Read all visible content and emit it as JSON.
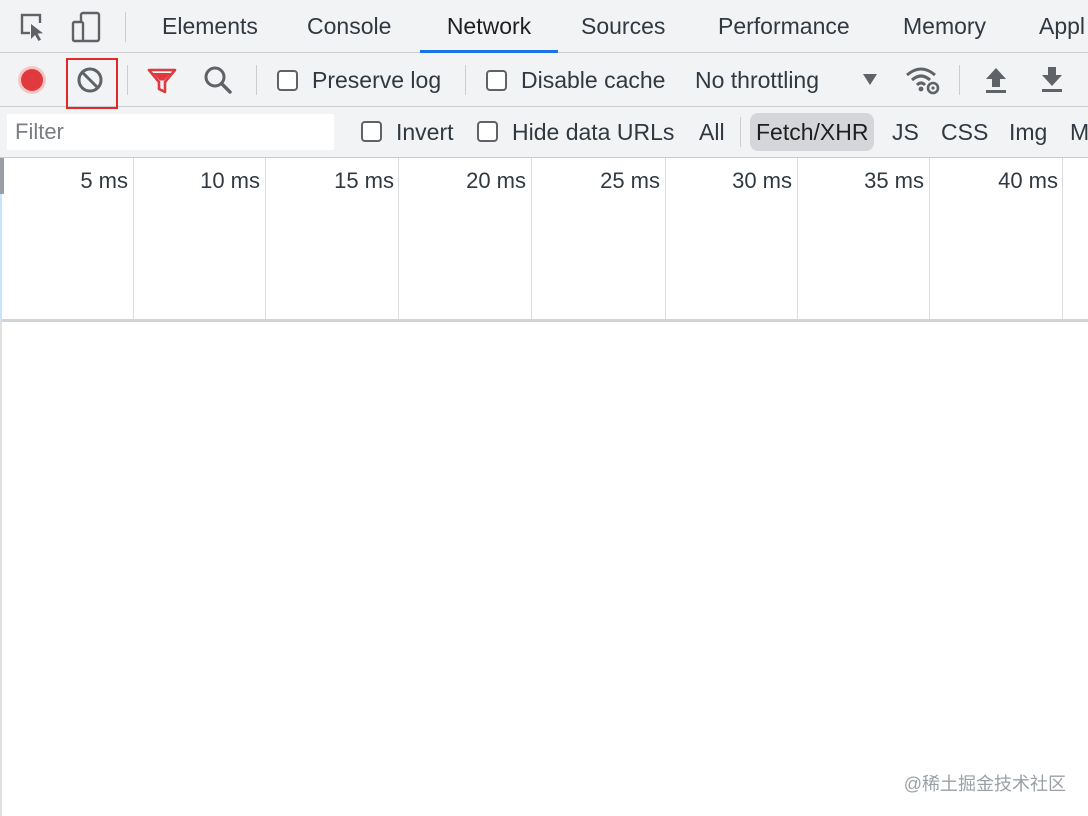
{
  "tabs": [
    {
      "label": "Elements"
    },
    {
      "label": "Console"
    },
    {
      "label": "Network",
      "active": true
    },
    {
      "label": "Sources"
    },
    {
      "label": "Performance"
    },
    {
      "label": "Memory"
    },
    {
      "label": "Appl"
    }
  ],
  "toolbar": {
    "record_color": "#e0393e",
    "preserve_log_label": "Preserve log",
    "preserve_log_checked": false,
    "disable_cache_label": "Disable cache",
    "disable_cache_checked": false,
    "throttling_value": "No throttling"
  },
  "filter": {
    "placeholder": "Filter",
    "value": "",
    "invert_label": "Invert",
    "hide_data_urls_label": "Hide data URLs",
    "types": [
      "All",
      "Fetch/XHR",
      "JS",
      "CSS",
      "Img",
      "M"
    ],
    "active_type": "Fetch/XHR"
  },
  "overview": {
    "ticks": [
      "5 ms",
      "10 ms",
      "15 ms",
      "20 ms",
      "25 ms",
      "30 ms",
      "35 ms",
      "40 ms"
    ]
  },
  "watermark": "@稀土掘金技术社区",
  "colors": {
    "accent": "#1a73e8",
    "highlight": "#e02a2a",
    "filter_icon": "#e0393e"
  },
  "icons": [
    "inspect-icon",
    "device-toggle-icon",
    "record-icon",
    "clear-icon",
    "filter-icon",
    "search-icon",
    "network-conditions-icon",
    "import-har-icon",
    "export-har-icon"
  ]
}
